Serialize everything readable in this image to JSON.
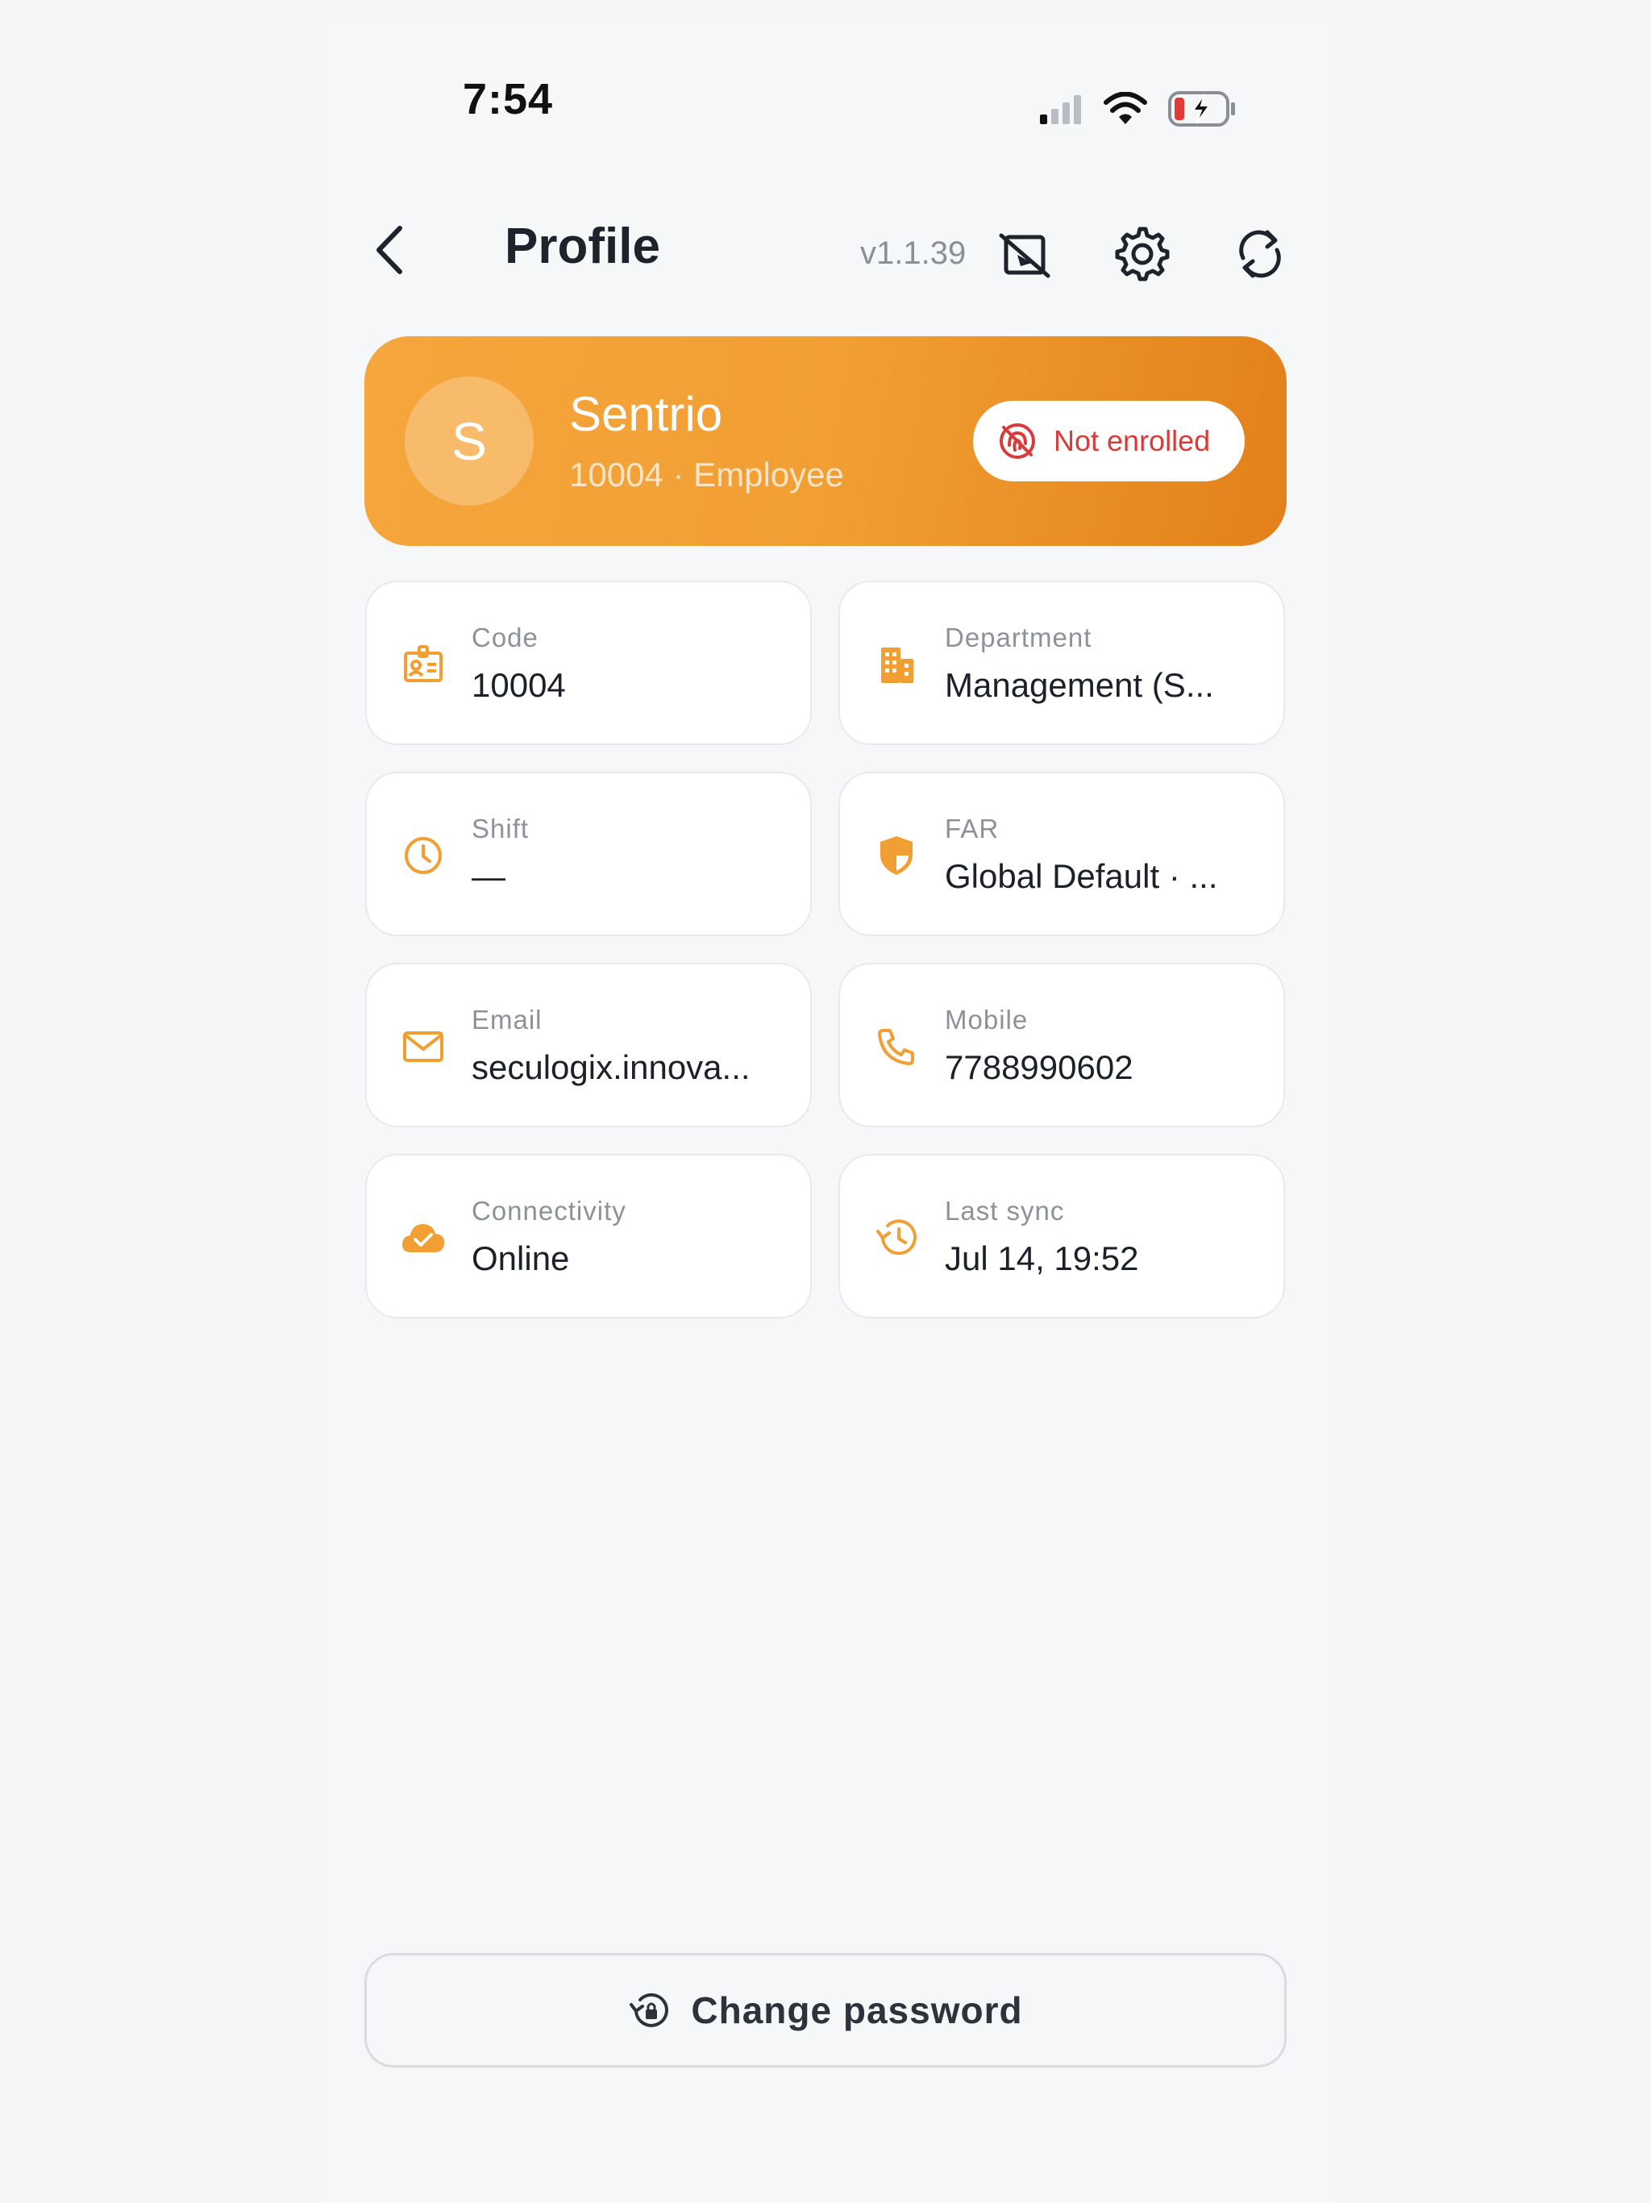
{
  "status_bar": {
    "time": "7:54"
  },
  "header": {
    "title": "Profile",
    "version": "v1.1.39"
  },
  "profile": {
    "avatar_initial": "S",
    "name": "Sentrio",
    "subtitle": "10004 · Employee",
    "enroll_status": "Not enrolled"
  },
  "cards": [
    {
      "label": "Code",
      "value": "10004",
      "icon": "id-badge-icon"
    },
    {
      "label": "Department",
      "value": "Management (S...",
      "icon": "building-icon"
    },
    {
      "label": "Shift",
      "value": "—",
      "icon": "clock-icon"
    },
    {
      "label": "FAR",
      "value": "Global Default · ...",
      "icon": "shield-icon"
    },
    {
      "label": "Email",
      "value": "seculogix.innova...",
      "icon": "envelope-icon"
    },
    {
      "label": "Mobile",
      "value": "7788990602",
      "icon": "phone-icon"
    },
    {
      "label": "Connectivity",
      "value": "Online",
      "icon": "cloud-check-icon"
    },
    {
      "label": "Last sync",
      "value": "Jul 14, 19:52",
      "icon": "history-icon"
    }
  ],
  "actions": {
    "change_password": "Change password"
  },
  "colors": {
    "accent": "#F19F33",
    "danger": "#D93A3A",
    "text": "#1C2029",
    "muted": "#8D9199"
  }
}
